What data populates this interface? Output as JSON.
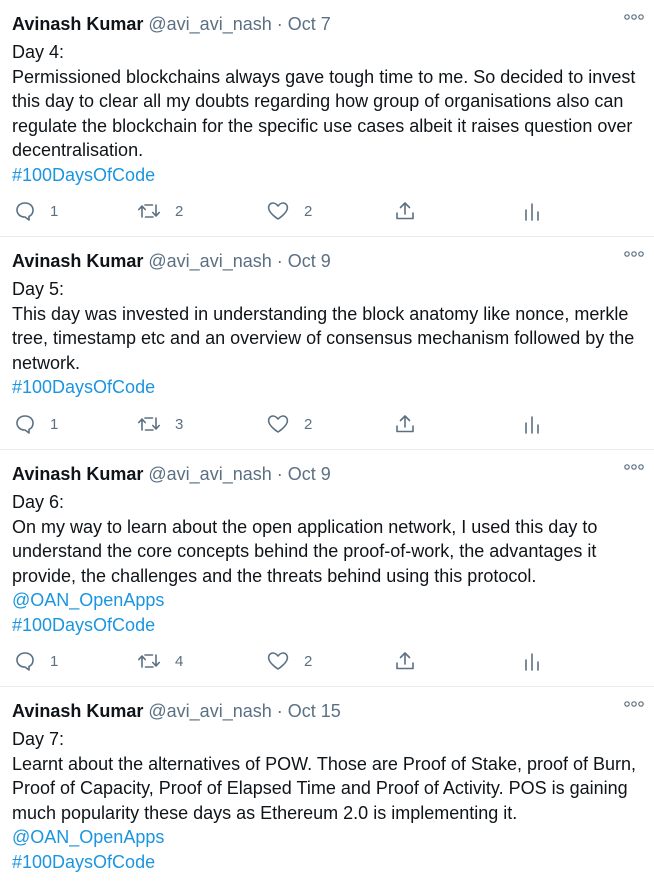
{
  "tweets": [
    {
      "name": "Avinash Kumar",
      "handle": "@avi_avi_nash",
      "dot": "·",
      "date": "Oct 7",
      "lines": [
        "Day 4:",
        "Permissioned blockchains always gave tough time to me. So decided to invest this day to clear all my doubts regarding how group of organisations also can regulate the blockchain for the specific use cases albeit it raises question over decentralisation."
      ],
      "links": [
        "#100DaysOfCode"
      ],
      "replies": "1",
      "retweets": "2",
      "likes": "2"
    },
    {
      "name": "Avinash Kumar",
      "handle": "@avi_avi_nash",
      "dot": "·",
      "date": "Oct 9",
      "lines": [
        "Day 5:",
        "This day was invested in understanding the block anatomy like nonce, merkle tree, timestamp etc and an overview of consensus mechanism followed by the network."
      ],
      "links": [
        "#100DaysOfCode"
      ],
      "replies": "1",
      "retweets": "3",
      "likes": "2"
    },
    {
      "name": "Avinash Kumar",
      "handle": "@avi_avi_nash",
      "dot": "·",
      "date": "Oct 9",
      "lines": [
        "Day 6:",
        "On my way to learn about the open application network, I used this day to understand the core concepts behind the proof-of-work, the advantages it provide, the challenges and the threats behind using this protocol."
      ],
      "links": [
        "@OAN_OpenApps",
        "#100DaysOfCode"
      ],
      "replies": "1",
      "retweets": "4",
      "likes": "2"
    },
    {
      "name": "Avinash Kumar",
      "handle": "@avi_avi_nash",
      "dot": "·",
      "date": "Oct 15",
      "lines": [
        "Day 7:",
        "Learnt about the alternatives of POW. Those are Proof of Stake, proof of Burn, Proof of Capacity, Proof of Elapsed Time and Proof of Activity. POS is gaining much popularity these days as Ethereum 2.0 is implementing it."
      ],
      "links": [
        "@OAN_OpenApps",
        "#100DaysOfCode"
      ]
    }
  ],
  "icons": {
    "more": "more-horizontal-icon",
    "reply": "reply-icon",
    "retweet": "retweet-icon",
    "like": "heart-icon",
    "share": "share-icon",
    "analytics": "analytics-icon"
  },
  "colors": {
    "name": "#0f1419",
    "muted": "#5b7083",
    "link": "#1b95e0",
    "divider": "#e6ecf0"
  }
}
